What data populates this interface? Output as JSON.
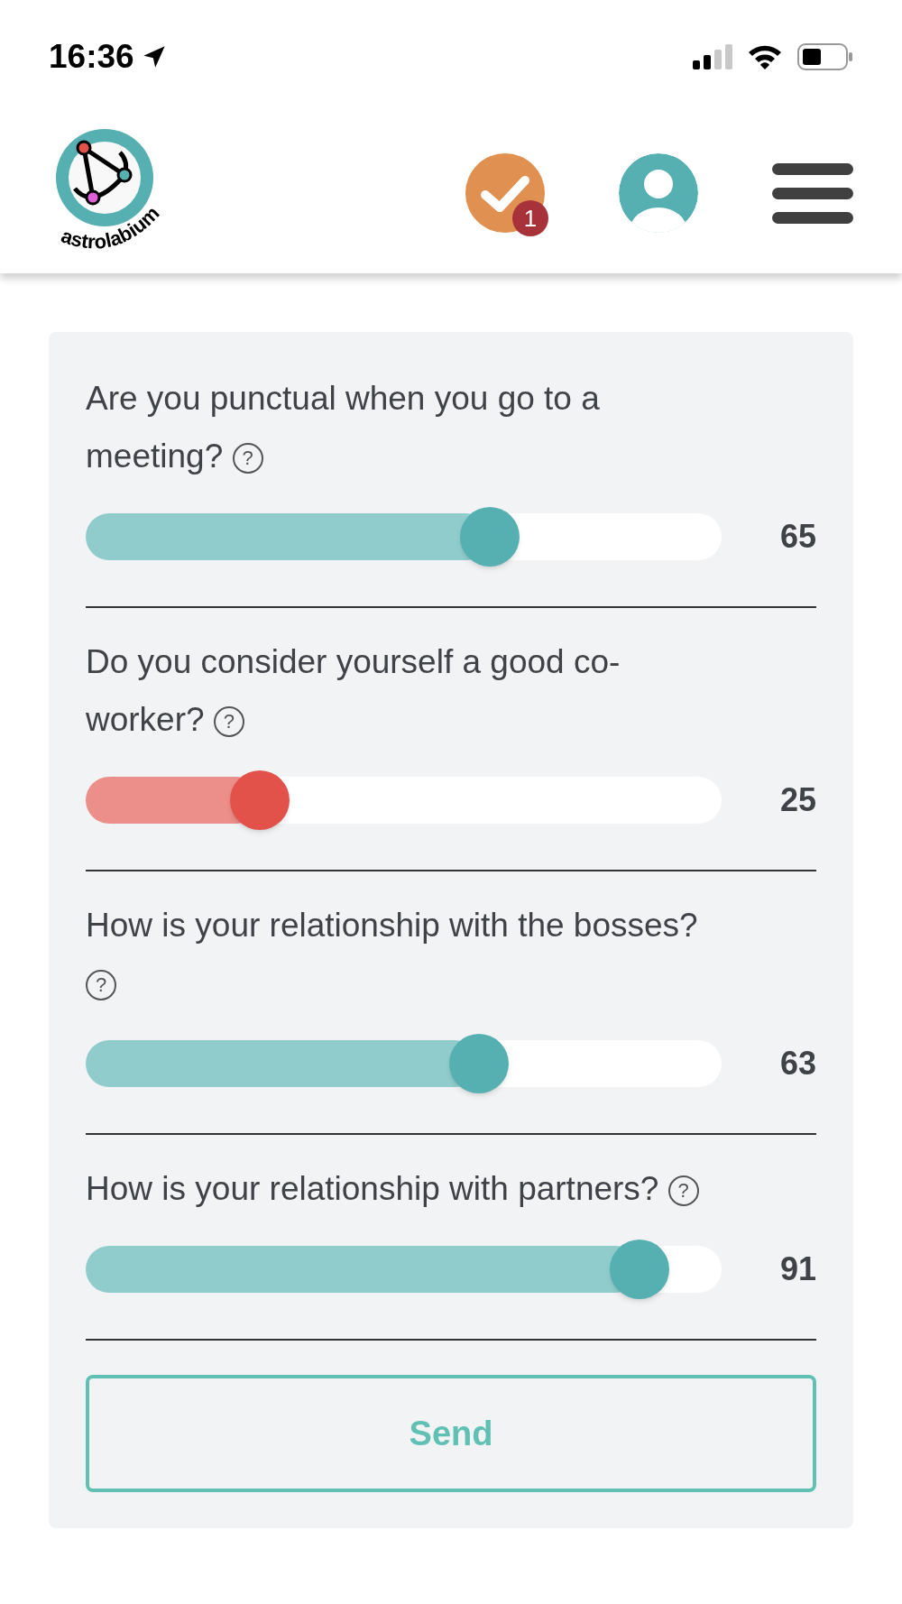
{
  "status_bar": {
    "time": "16:36"
  },
  "header": {
    "logo_text": "astrolabium",
    "notifications_badge": "1"
  },
  "questions": [
    {
      "text": "Are you punctual when you go to a meeting?",
      "level": 0.65,
      "reading": "65",
      "color": "#56b0b2"
    },
    {
      "text": "Do you consider yourself a good co-worker?",
      "level": 0.25,
      "reading": "25",
      "color": "#e2524a"
    },
    {
      "text": "How is your relationship with the bosses?",
      "level": 0.63,
      "reading": "63",
      "color": "#56b0b2"
    },
    {
      "text": "How is your relationship with partners?",
      "level": 0.91,
      "reading": "91",
      "color": "#56b0b2"
    }
  ],
  "help_mark": "?",
  "send_button": "Send"
}
